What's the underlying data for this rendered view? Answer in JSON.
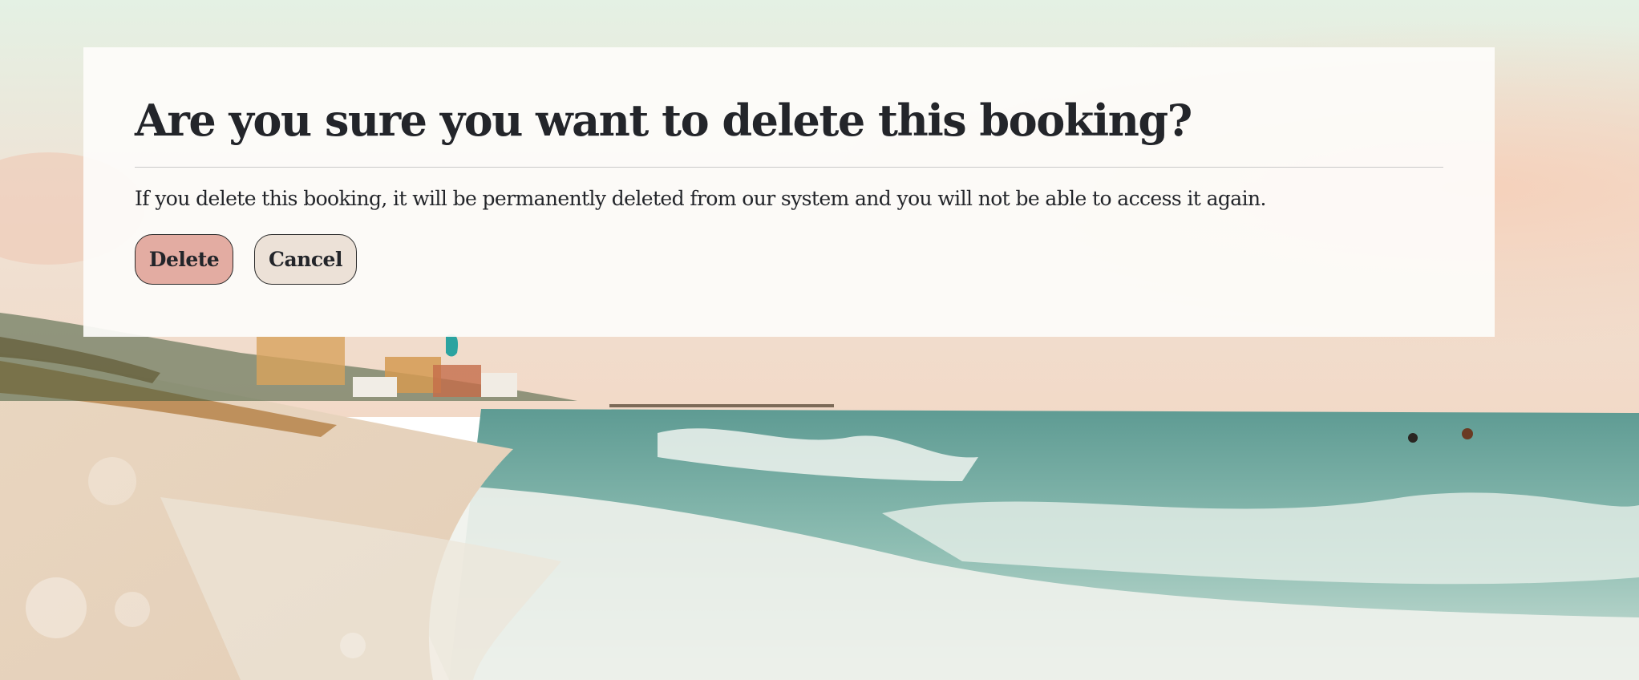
{
  "dialog": {
    "title": "Are you sure you want to delete this booking?",
    "message": "If you delete this booking, it will be permanently deleted from our system and you will not be able to access it again.",
    "delete_label": "Delete",
    "cancel_label": "Cancel"
  },
  "colors": {
    "delete_button": "#e3aca2",
    "cancel_button": "#ece1d7",
    "text": "#23252a"
  }
}
